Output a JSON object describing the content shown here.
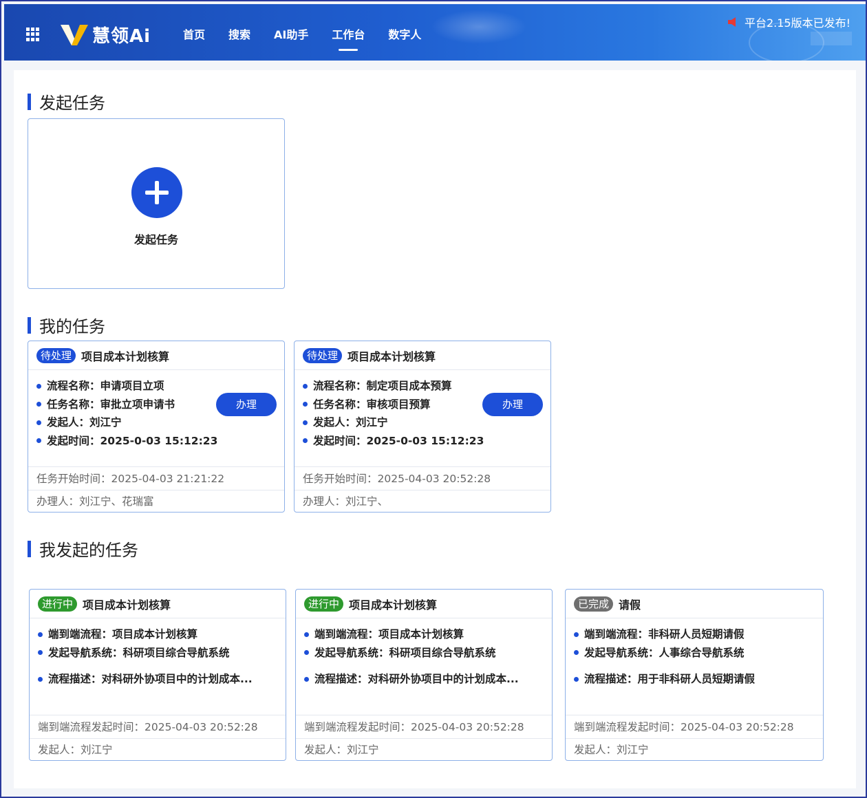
{
  "header": {
    "brand": "慧领Ai",
    "nav": [
      "首页",
      "搜索",
      "AI助手",
      "工作台",
      "数字人"
    ],
    "active_nav": "工作台",
    "notice": "平台2.15版本已发布!",
    "colors": {
      "primary": "#1d4fd8",
      "header_start": "#1a48b0",
      "header_end": "#4fa0ef"
    }
  },
  "sections": {
    "start": "发起任务",
    "mine": "我的任务",
    "initiated": "我发起的任务"
  },
  "start_card": {
    "label": "发起任务",
    "icon": "plus-icon"
  },
  "my_tasks": [
    {
      "status": "待处理",
      "title": "项目成本计划核算",
      "rows": [
        "流程名称：申请项目立项",
        "任务名称：审批立项申请书",
        "发起人：刘江宁",
        "发起时间：2025-0-03 15:12:23"
      ],
      "button": "办理",
      "start_time": "任务开始时间：2025-04-03 21:21:22",
      "handler": "办理人：刘江宁、花瑞富"
    },
    {
      "status": "待处理",
      "title": "项目成本计划核算",
      "rows": [
        "流程名称：制定项目成本预算",
        "任务名称：审核项目预算",
        "发起人：刘江宁",
        "发起时间：2025-0-03 15:12:23"
      ],
      "button": "办理",
      "start_time": "任务开始时间：2025-04-03 20:52:28",
      "handler": "办理人：刘江宁、"
    }
  ],
  "initiated_tasks": [
    {
      "status": "进行中",
      "status_color": "#2e9a2e",
      "title": "项目成本计划核算",
      "rows": [
        "端到端流程：项目成本计划核算",
        "发起导航系统：科研项目综合导航系统"
      ],
      "desc": "流程描述：对科研外协项目中的计划成本...",
      "start_time": "端到端流程发起时间：2025-04-03 20:52:28",
      "initiator": "发起人：刘江宁"
    },
    {
      "status": "进行中",
      "status_color": "#2e9a2e",
      "title": "项目成本计划核算",
      "rows": [
        "端到端流程：项目成本计划核算",
        "发起导航系统：科研项目综合导航系统"
      ],
      "desc": "流程描述：对科研外协项目中的计划成本...",
      "start_time": "端到端流程发起时间：2025-04-03 20:52:28",
      "initiator": "发起人：刘江宁"
    },
    {
      "status": "已完成",
      "status_color": "#6f6f6f",
      "title": "请假",
      "rows": [
        "端到端流程：非科研人员短期请假",
        "发起导航系统：人事综合导航系统"
      ],
      "desc": "流程描述：用于非科研人员短期请假",
      "start_time": "端到端流程发起时间：2025-04-03 20:52:28",
      "initiator": "发起人：刘江宁"
    }
  ]
}
